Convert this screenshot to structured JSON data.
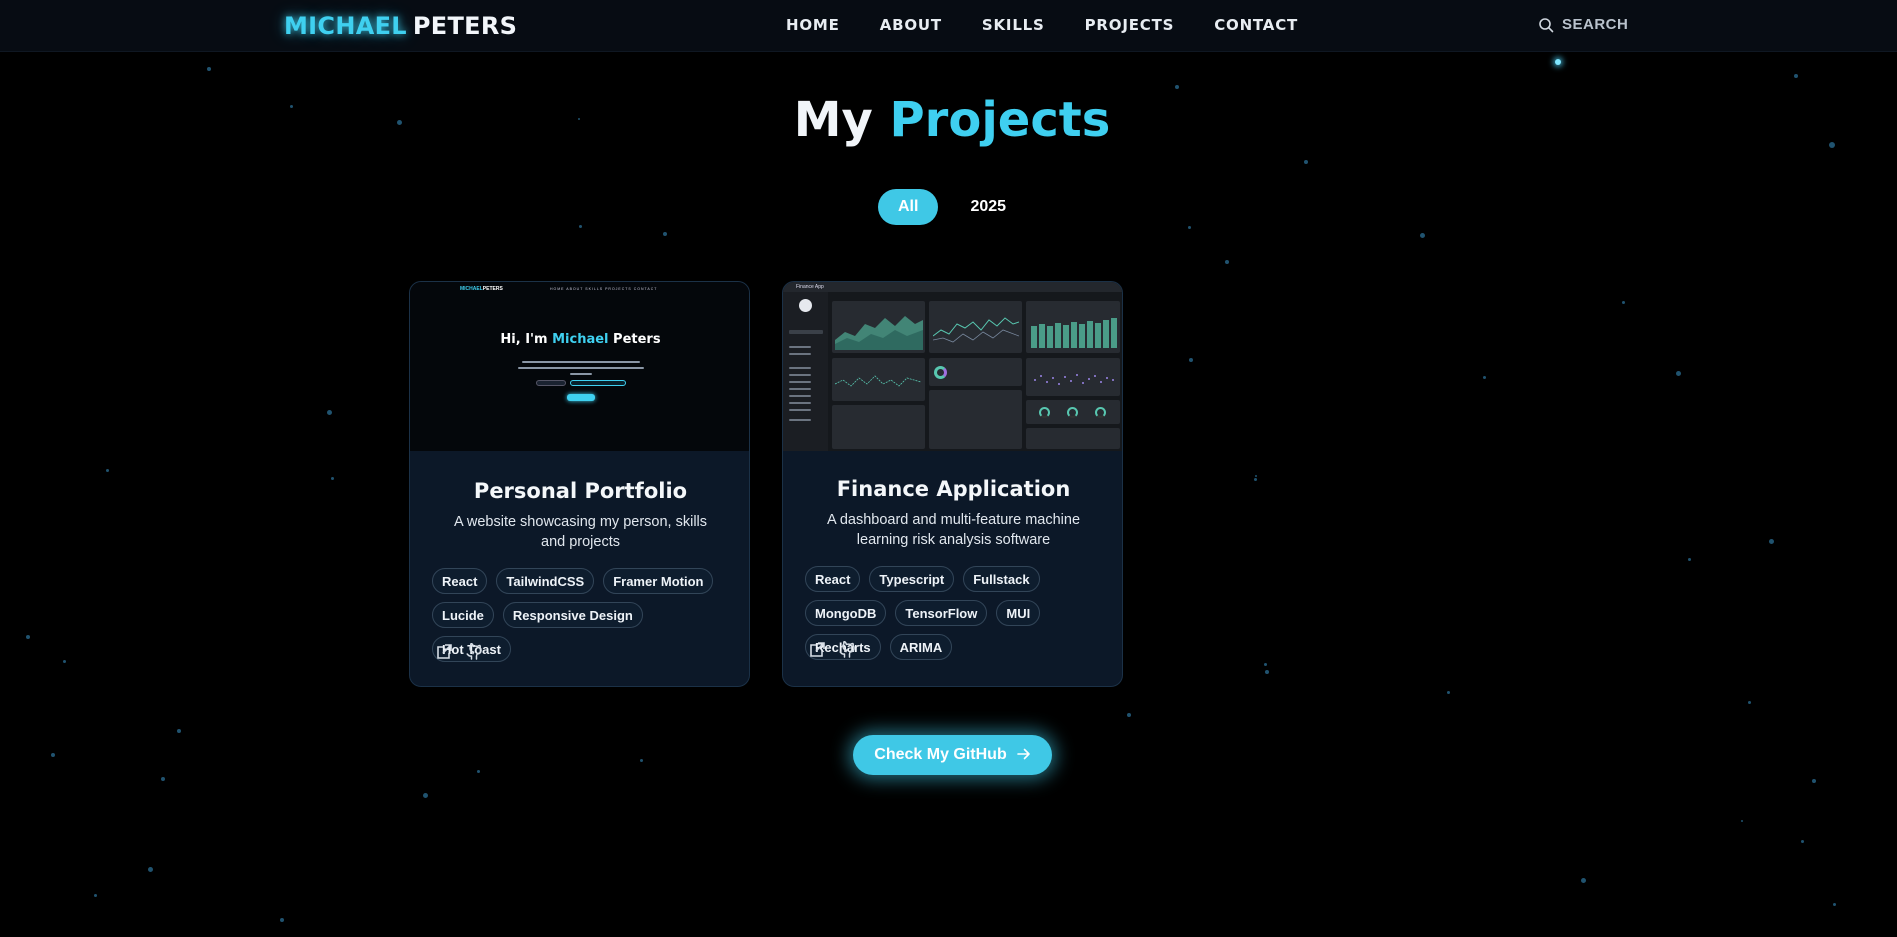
{
  "nav": {
    "logo_first": "MICHAEL",
    "logo_last": "PETERS",
    "links": [
      "HOME",
      "ABOUT",
      "SKILLS",
      "PROJECTS",
      "CONTACT"
    ],
    "search_label": "SEARCH"
  },
  "heading": {
    "word1": "My",
    "word2": "Projects"
  },
  "filters": {
    "all": "All",
    "year": "2025",
    "active": "All"
  },
  "projects": [
    {
      "title": "Personal Portfolio",
      "description": "A website showcasing my person, skills and projects",
      "tags": [
        "React",
        "TailwindCSS",
        "Framer Motion",
        "Lucide",
        "Responsive Design",
        "Hot Toast"
      ],
      "preview": {
        "logo_first": "MICHAEL",
        "logo_last": "PETERS",
        "links": "HOME ABOUT SKILLS PROJECTS CONTACT",
        "hero_prefix": "Hi, I'm",
        "hero_name": "Michael",
        "hero_suffix": "Peters"
      }
    },
    {
      "title": "Finance Application",
      "description": "A dashboard and multi-feature machine learning risk analysis software",
      "tags": [
        "React",
        "Typescript",
        "Fullstack",
        "MongoDB",
        "TensorFlow",
        "MUI",
        "Recharts",
        "ARIMA"
      ],
      "preview": {
        "app_name": "Finance App"
      }
    }
  ],
  "cta": {
    "label": "Check My GitHub"
  },
  "icons": {
    "search": "search-icon",
    "external": "external-link-icon",
    "github": "github-icon",
    "arrow": "arrow-right-icon"
  },
  "colors": {
    "accent": "#3fc8e6",
    "background": "#000000",
    "card": "#0c1828"
  }
}
